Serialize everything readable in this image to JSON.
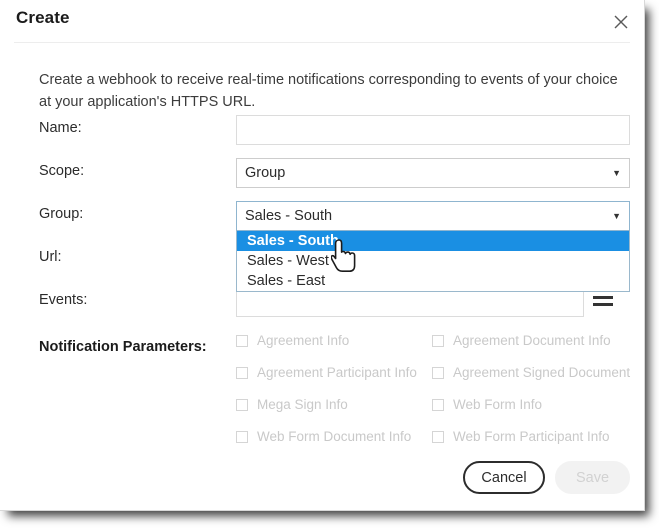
{
  "dialog": {
    "title": "Create",
    "close_icon": "close-icon",
    "intro": "Create a webhook to receive real-time notifications corresponding to events of your choice at your application's HTTPS URL."
  },
  "form": {
    "name": {
      "label": "Name:",
      "value": "",
      "placeholder": ""
    },
    "scope": {
      "label": "Scope:",
      "value": "Group",
      "caret": "▼"
    },
    "group": {
      "label": "Group:",
      "value": "Sales - South",
      "caret": "▼",
      "open": true,
      "options": [
        "Sales - South",
        "Sales - West",
        "Sales - East"
      ],
      "selected_index": 0
    },
    "url": {
      "label": "Url:",
      "value": "",
      "placeholder": ""
    },
    "events": {
      "label": "Events:",
      "value": "",
      "handle_icon": "list-menu-icon",
      "caret": "▼"
    }
  },
  "notification_parameters": {
    "label": "Notification Parameters:",
    "items": [
      {
        "label": "Agreement Info",
        "checked": false,
        "disabled": true
      },
      {
        "label": "Agreement Document Info",
        "checked": false,
        "disabled": true
      },
      {
        "label": "Agreement Participant Info",
        "checked": false,
        "disabled": true
      },
      {
        "label": "Agreement Signed Document",
        "checked": false,
        "disabled": true
      },
      {
        "label": "Mega Sign Info",
        "checked": false,
        "disabled": true
      },
      {
        "label": "Web Form Info",
        "checked": false,
        "disabled": true
      },
      {
        "label": "Web Form Document Info",
        "checked": false,
        "disabled": true
      },
      {
        "label": "Web Form Participant Info",
        "checked": false,
        "disabled": true
      }
    ]
  },
  "footer": {
    "cancel_label": "Cancel",
    "save_label": "Save",
    "save_disabled": true
  },
  "colors": {
    "highlight_blue": "#1a8fe3",
    "focus_border": "#8fb5cf",
    "text": "#2b2b2b",
    "disabled_text": "#c9c9c9"
  },
  "cursor": {
    "type": "pointer-hand-cursor"
  }
}
